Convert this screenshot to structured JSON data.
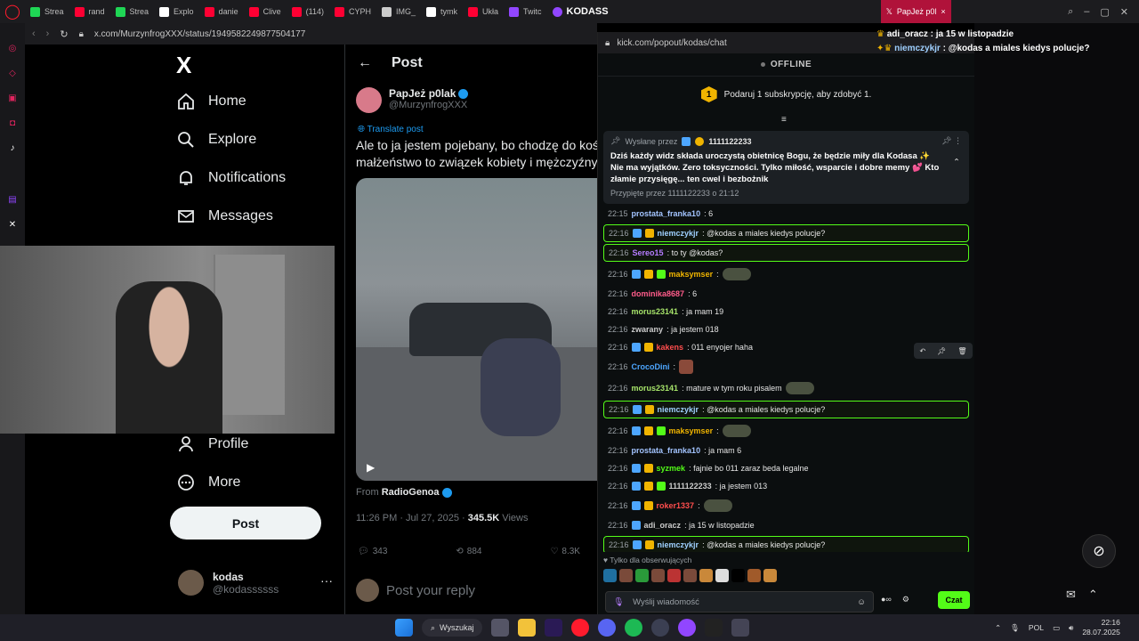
{
  "browser": {
    "tabs": [
      {
        "label": "Strea",
        "color": "#1fd655"
      },
      {
        "label": "rand",
        "color": "#ff0033"
      },
      {
        "label": "Strea",
        "color": "#1fd655"
      },
      {
        "label": "Explo",
        "color": "#ffffff"
      },
      {
        "label": "danie",
        "color": "#ff0033"
      },
      {
        "label": "Clive",
        "color": "#ff0033"
      },
      {
        "label": "(114)",
        "color": "#ff0033"
      },
      {
        "label": "CYPH",
        "color": "#ff0033"
      },
      {
        "label": "IMG_",
        "color": "#cccccc"
      },
      {
        "label": "tymk",
        "color": "#ffffff"
      },
      {
        "label": "Ukła",
        "color": "#ff0033"
      },
      {
        "label": "Twitc",
        "color": "#9146ff"
      }
    ],
    "active_tab": "PapJeż p0l",
    "kodass_tab": "KODASS",
    "url": "x.com/MurzynfrogXXX/status/1949582249877504177"
  },
  "x_nav": {
    "logo": "X",
    "items": [
      "Home",
      "Explore",
      "Notifications",
      "Messages",
      "Profile",
      "More"
    ],
    "post_button": "Post",
    "account": {
      "name": "kodas",
      "handle": "@kodassssss",
      "more": "···"
    }
  },
  "post": {
    "header": "Post",
    "author_name": "PapJeż p0lak",
    "author_handle": "@MurzynfrogXXX",
    "translate": "Translate post",
    "text_line1": "Ale to ja jestem pojebany, bo chodzę do kościoła",
    "text_line2": "małżeństwo to związek kobiety i mężczyźny.",
    "from_label": "From",
    "from_source": "RadioGenoa",
    "time": "11:26 PM · Jul 27, 2025 · ",
    "views_count": "345.5K",
    "views_label": " Views",
    "replies": "343",
    "reposts": "884",
    "likes": "8.3K",
    "reply_placeholder": "Post your reply"
  },
  "kick": {
    "url": "kick.com/popout/kodas/chat",
    "status": "OFFLINE",
    "gift_badge": "1",
    "gift_text": "Podaruj 1 subskrypcję, aby zdobyć 1.",
    "pinned_by_label": "Wysłane przez",
    "pinned_user": "1111122233",
    "pinned_msg": "Dziś każdy widz składa uroczystą obietnicę Bogu, że będzie miły dla Kodasa ✨ Nie ma wyjątków. Zero toksyczności. Tylko miłość, wsparcie i dobre memy 💕 Kto złamie przysięgę... ten cwel i bezbożnik",
    "pinned_footer": "Przypięte przez 1111122233 o 21:12",
    "messages": [
      {
        "t": "22:15",
        "u": "prostata_franka10",
        "c": "#a3c4ff",
        "m": ": 6",
        "hl": false,
        "b": 0,
        "e": false
      },
      {
        "t": "22:16",
        "u": "niemczykjr",
        "c": "#9fd0ff",
        "m": ": @kodas a miales kiedys polucje?",
        "hl": true,
        "b": 2,
        "e": false
      },
      {
        "t": "22:16",
        "u": "Sereo15",
        "c": "#b57cff",
        "m": ": to ty @kodas?",
        "hl": true,
        "b": 0,
        "e": false
      },
      {
        "t": "22:16",
        "u": "maksymser",
        "c": "#f0b400",
        "m": ":",
        "hl": false,
        "b": 3,
        "e": true
      },
      {
        "t": "22:16",
        "u": "dominika8687",
        "c": "#ff5c8a",
        "m": ": 6",
        "hl": false,
        "b": 0,
        "e": false
      },
      {
        "t": "22:16",
        "u": "morus23141",
        "c": "#a6e36a",
        "m": ": ja mam 19",
        "hl": false,
        "b": 0,
        "e": false
      },
      {
        "t": "22:16",
        "u": "zwarany",
        "c": "#cccccc",
        "m": ": ja jestem 018",
        "hl": false,
        "b": 0,
        "e": false
      },
      {
        "t": "22:16",
        "u": "kakens",
        "c": "#ff4d4d",
        "m": ": 011 enyojer haha",
        "hl": false,
        "b": 2,
        "e": false
      },
      {
        "t": "22:16",
        "u": "CrocoDini",
        "c": "#4da6ff",
        "m": ":",
        "hl": false,
        "b": 0,
        "e": true
      },
      {
        "t": "22:16",
        "u": "morus23141",
        "c": "#a6e36a",
        "m": ": mature w tym roku pisalem",
        "hl": false,
        "b": 0,
        "e": true
      },
      {
        "t": "22:16",
        "u": "niemczykjr",
        "c": "#9fd0ff",
        "m": ": @kodas a miales kiedys polucje?",
        "hl": true,
        "b": 2,
        "e": false
      },
      {
        "t": "22:16",
        "u": "maksymser",
        "c": "#f0b400",
        "m": ":",
        "hl": false,
        "b": 3,
        "e": true
      },
      {
        "t": "22:16",
        "u": "prostata_franka10",
        "c": "#a3c4ff",
        "m": ": ja mam 6",
        "hl": false,
        "b": 0,
        "e": false
      },
      {
        "t": "22:16",
        "u": "syzmek",
        "c": "#53fc18",
        "m": ": fajnie bo 011 zaraz beda legalne",
        "hl": false,
        "b": 2,
        "e": false
      },
      {
        "t": "22:16",
        "u": "1111122233",
        "c": "#cccccc",
        "m": ": ja jestem 013",
        "hl": false,
        "b": 3,
        "e": false
      },
      {
        "t": "22:16",
        "u": "roker1337",
        "c": "#ff4d4d",
        "m": ":",
        "hl": false,
        "b": 2,
        "e": true
      },
      {
        "t": "22:16",
        "u": "adi_oracz",
        "c": "#cccccc",
        "m": ": ja 15 w listopadzie",
        "hl": false,
        "b": 1,
        "e": false
      },
      {
        "t": "22:16",
        "u": "niemczykjr",
        "c": "#9fd0ff",
        "m": ": @kodas a miales kiedys polucje?",
        "hl": true,
        "b": 2,
        "e": false
      }
    ],
    "followers_only": "Tylko dla obserwujących",
    "input_placeholder": "Wyślij wiadomość",
    "send": "Czat"
  },
  "overlay": {
    "line1_user": "adi_oracz",
    "line1_msg": " : ja 15 w listopadzie",
    "line2_user": "niemczykjr",
    "line2_msg": " : @kodas a miales kiedys polucje?"
  },
  "taskbar": {
    "search": "Wyszukaj",
    "lang": "POL",
    "time": "22:16",
    "date": "28.07.2025"
  }
}
